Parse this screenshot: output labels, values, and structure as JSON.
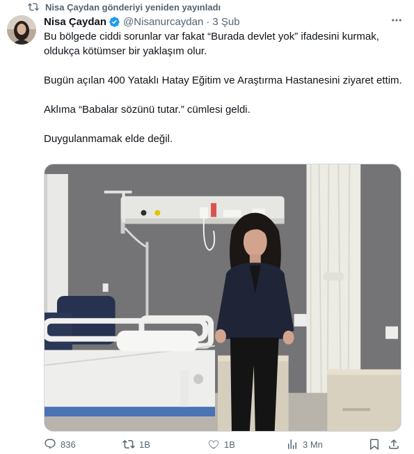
{
  "repost": {
    "icon": "retweet-icon",
    "text": "Nisa Çaydan gönderiyi yeniden yayınladı"
  },
  "author": {
    "name": "Nisa Çaydan",
    "verified_icon": "verified-badge-icon",
    "handle": "@Nisanurcaydan",
    "separator": "·",
    "time": "3 Şub"
  },
  "tweet": {
    "paragraphs": [
      "Bu bölgede ciddi sorunlar var fakat “Burada devlet yok” ifadesini kurmak, oldukça kötümser bir yaklaşım olur.",
      "Bugün açılan 400 Yataklı Hatay Eğitim ve Araştırma Hastanesini ziyaret ettim.",
      "Aklıma “Babalar sözünü tutar.” cümlesi geldi.",
      "Duygulanmamak elde değil."
    ]
  },
  "media": {
    "icon": "hospital-room-photo"
  },
  "actions": {
    "replies": "836",
    "retweets": "1B",
    "likes": "1B",
    "views": "3 Mn"
  },
  "colors": {
    "text": "#0f1419",
    "secondary": "#536471",
    "verified": "#1d9bf0",
    "border": "#cfd9de"
  }
}
